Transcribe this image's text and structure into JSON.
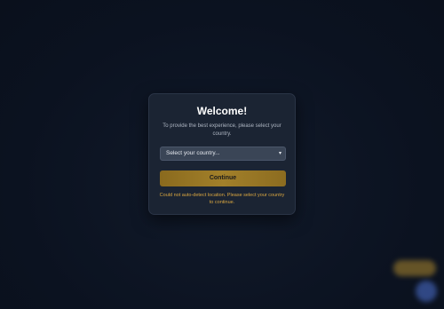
{
  "modal": {
    "title": "Welcome!",
    "subtitle": "To provide the best experience, please select your country.",
    "country_select": {
      "selected": "Select your country...",
      "chevron_icon": "chevron-down-icon"
    },
    "continue_label": "Continue",
    "error_message": "Could not auto-detect location. Please select your country to continue."
  },
  "colors": {
    "background": "#0b1220",
    "modal_bg": "#1b2433",
    "accent": "#a2802a",
    "error": "#d9a640"
  }
}
